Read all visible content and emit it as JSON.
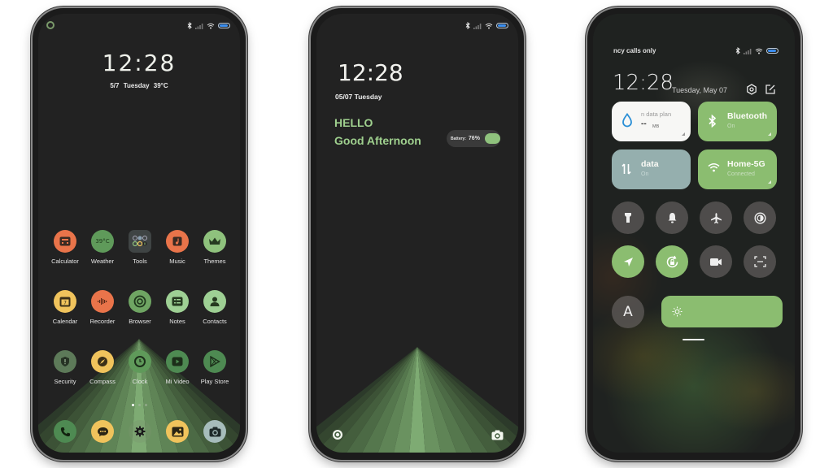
{
  "status_bar": {
    "icons": [
      "bluetooth-icon",
      "signal-icon",
      "wifi-icon",
      "battery-icon"
    ],
    "accent_battery": "#3b8ef0"
  },
  "home_screen": {
    "clock": "12:28",
    "date_line": "5/7  Tuesday   39°C",
    "apps": [
      {
        "label": "Calculator",
        "icon": "calculator-icon",
        "color": "#e9744a"
      },
      {
        "label": "Weather",
        "icon": "weather-icon",
        "color": "#5f9a5a",
        "badge": "39°C"
      },
      {
        "label": "Tools",
        "icon": "tools-folder-icon",
        "color": "#3f4444"
      },
      {
        "label": "Music",
        "icon": "music-icon",
        "color": "#e9744a"
      },
      {
        "label": "Themes",
        "icon": "themes-crown-icon",
        "color": "#8fc27d"
      },
      {
        "label": "Calendar",
        "icon": "calendar-icon",
        "color": "#f0c35c",
        "badge": "7"
      },
      {
        "label": "Recorder",
        "icon": "recorder-icon",
        "color": "#e9744a"
      },
      {
        "label": "Browser",
        "icon": "browser-icon",
        "color": "#6fa563"
      },
      {
        "label": "Notes",
        "icon": "notes-icon",
        "color": "#9ed094"
      },
      {
        "label": "Contacts",
        "icon": "contacts-icon",
        "color": "#9ed094"
      },
      {
        "label": "Security",
        "icon": "security-shield-icon",
        "color": "#5d7a59"
      },
      {
        "label": "Compass",
        "icon": "compass-icon",
        "color": "#f0c35c"
      },
      {
        "label": "Clock",
        "icon": "clock-icon",
        "color": "#5f9a5a"
      },
      {
        "label": "Mi Video",
        "icon": "video-icon",
        "color": "#4e8a52"
      },
      {
        "label": "Play Store",
        "icon": "play-store-icon",
        "color": "#4e8a52"
      }
    ],
    "page_indicator": {
      "pages": 3,
      "current": 1
    },
    "dock": [
      {
        "name": "phone",
        "icon": "phone-icon",
        "color": "#4e8a52"
      },
      {
        "name": "messages",
        "icon": "messages-icon",
        "color": "#f0c35c"
      },
      {
        "name": "settings",
        "icon": "settings-gear-icon",
        "color": "transparent"
      },
      {
        "name": "gallery",
        "icon": "gallery-icon",
        "color": "#f0c35c"
      },
      {
        "name": "camera",
        "icon": "camera-icon",
        "color": "#a6bcbb"
      }
    ]
  },
  "lock_screen": {
    "clock": "12:28",
    "date": "05/07 Tuesday",
    "greeting_1": "HELLO",
    "greeting_2": "Good Afternoon",
    "battery_label": "Battery:",
    "battery_value": "76%",
    "battery_percent": 76,
    "accent": "#9fd08e"
  },
  "control_center": {
    "carrier": "ncy calls only",
    "clock": "12:28",
    "date": "Tuesday, May 07",
    "tiles": [
      {
        "title": "n data plan",
        "value": "-- ",
        "unit": "MB",
        "icon": "water-drop-icon",
        "style": "light"
      },
      {
        "title": "Bluetooth",
        "subtitle": "On",
        "icon": "bluetooth-icon",
        "style": "green"
      },
      {
        "title": "data",
        "subtitle": "On",
        "icon": "mobile-data-icon",
        "style": "slate"
      },
      {
        "title": "Home-5G",
        "subtitle": "Connected",
        "icon": "wifi-icon",
        "style": "green"
      }
    ],
    "toggles": [
      {
        "name": "flashlight",
        "icon": "flashlight-icon",
        "on": false
      },
      {
        "name": "silent",
        "icon": "bell-icon",
        "on": false
      },
      {
        "name": "airplane-mode",
        "icon": "airplane-icon",
        "on": false
      },
      {
        "name": "dark-mode",
        "icon": "contrast-icon",
        "on": false
      },
      {
        "name": "location",
        "icon": "location-arrow-icon",
        "on": true
      },
      {
        "name": "rotation-lock",
        "icon": "rotation-lock-icon",
        "on": true
      },
      {
        "name": "screen-record",
        "icon": "video-camera-icon",
        "on": false
      },
      {
        "name": "scanner",
        "icon": "scan-icon",
        "on": false
      },
      {
        "name": "auto-brightness",
        "icon": "letter-a-icon",
        "on": false
      }
    ],
    "auto_brightness_label": "A",
    "accent": "#8bbd70"
  }
}
